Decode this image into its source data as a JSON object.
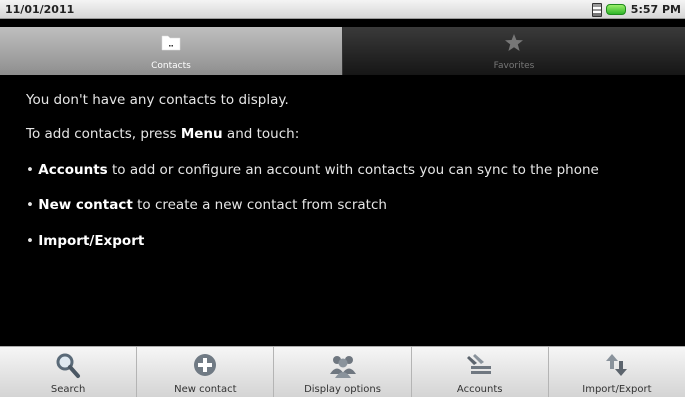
{
  "status_bar": {
    "date": "11/01/2011",
    "time": "5:57 PM",
    "icons": [
      "sim-icon",
      "battery-icon"
    ]
  },
  "tabs": [
    {
      "label": "Contacts",
      "icon": "folder-icon",
      "selected": true
    },
    {
      "label": "Favorites",
      "icon": "star-icon",
      "selected": false
    }
  ],
  "content": {
    "line1": "You don't have any contacts to display.",
    "line2_pre": "To add contacts, press ",
    "line2_bold": "Menu",
    "line2_post": " and touch:",
    "bullet": "•",
    "item1_bold": "Accounts",
    "item1_rest": " to add or configure an account with contacts you can sync to the phone",
    "item2_bold": "New contact",
    "item2_rest": " to create a new contact from scratch",
    "item3_bold": "Import/Export"
  },
  "menu": {
    "items": [
      {
        "label": "Search",
        "icon": "search-icon"
      },
      {
        "label": "New contact",
        "icon": "plus-icon"
      },
      {
        "label": "Display options",
        "icon": "people-icon"
      },
      {
        "label": "Accounts",
        "icon": "accounts-icon"
      },
      {
        "label": "Import/Export",
        "icon": "import-export-icon"
      }
    ]
  }
}
